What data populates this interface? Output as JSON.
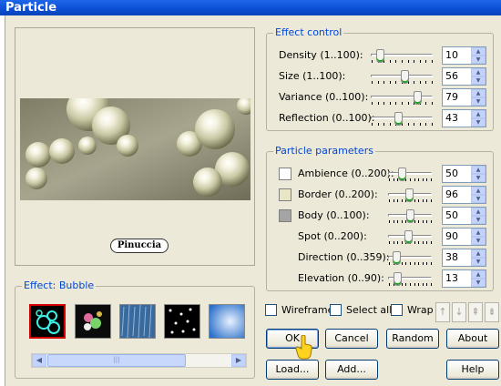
{
  "window": {
    "title": "Particle"
  },
  "preview": {
    "logo_text": "Pinuccia"
  },
  "effect": {
    "group_label": "Effect: Bubble",
    "thumbnails": [
      {
        "name": "bubble",
        "selected": true
      },
      {
        "name": "sparkle",
        "selected": false
      },
      {
        "name": "rain",
        "selected": false
      },
      {
        "name": "stars",
        "selected": false
      },
      {
        "name": "sky",
        "selected": false
      }
    ],
    "scroll_thumb": "|||"
  },
  "effect_control": {
    "group_label": "Effect control",
    "rows": [
      {
        "label": "Density (1..100):",
        "value": "10",
        "min": 1,
        "max": 100
      },
      {
        "label": "Size (1..100):",
        "value": "56",
        "min": 1,
        "max": 100
      },
      {
        "label": "Variance (0..100):",
        "value": "79",
        "min": 0,
        "max": 100
      },
      {
        "label": "Reflection (0..100):",
        "value": "43",
        "min": 0,
        "max": 100
      }
    ]
  },
  "particle_parameters": {
    "group_label": "Particle parameters",
    "rows": [
      {
        "label": "Ambience (0..200):",
        "value": "50",
        "min": 0,
        "max": 200,
        "swatch": "#ffffff"
      },
      {
        "label": "Border (0..200):",
        "value": "96",
        "min": 0,
        "max": 200,
        "swatch": "#e8e6c4"
      },
      {
        "label": "Body (0..100):",
        "value": "50",
        "min": 0,
        "max": 100,
        "swatch": "#a4a4a4"
      },
      {
        "label": "Spot (0..200):",
        "value": "90",
        "min": 0,
        "max": 200,
        "swatch": null
      },
      {
        "label": "Direction (0..359):",
        "value": "38",
        "min": 0,
        "max": 359,
        "swatch": null
      },
      {
        "label": "Elevation (0..90):",
        "value": "13",
        "min": 0,
        "max": 90,
        "swatch": null
      }
    ]
  },
  "options": {
    "wireframe": "Wireframe",
    "select_all": "Select all",
    "wrap": "Wrap"
  },
  "buttons": {
    "ok": "OK",
    "cancel": "Cancel",
    "random": "Random",
    "about": "About",
    "load": "Load...",
    "add": "Add...",
    "help": "Help"
  },
  "colors": {
    "title_bar": "#0a4ed4",
    "legend_text": "#0046d5",
    "dialog_bg": "#ECE9D8",
    "selected_thumb_border": "#d40000"
  }
}
